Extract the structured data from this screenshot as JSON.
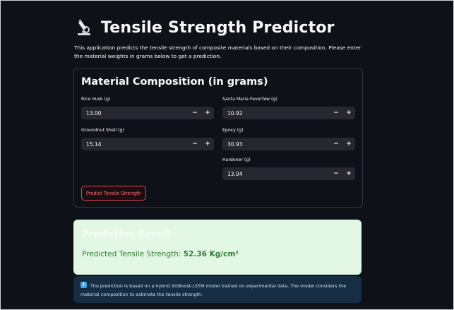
{
  "page": {
    "title": "Tensile Strength Predictor",
    "title_icon": "microscope-icon",
    "intro": "This application predicts the tensile strength of composite materials based on their composition. Please enter the material weights in grams below to get a prediction."
  },
  "form": {
    "title": "Material Composition (in grams)",
    "fields": [
      {
        "label": "Rice Husk (g)",
        "value": "13.00"
      },
      {
        "label": "Santa Maria Feverfew (g)",
        "value": "10.92"
      },
      {
        "label": "Groundnut Shell (g)",
        "value": "15.14"
      },
      {
        "label": "Epoxy (g)",
        "value": "30.93"
      },
      {
        "label": "Hardener (g)",
        "value": "13.04"
      }
    ],
    "minus_label": "−",
    "plus_label": "+",
    "submit_label": "Predict Tensile Strength"
  },
  "result": {
    "heading": "Prediction Result",
    "prefix": "Predicted Tensile Strength: ",
    "value": "52.36 Kg/cm²"
  },
  "info": {
    "icon": "info-icon",
    "icon_glyph": "i",
    "text": "The prediction is based on a hybrid XGBoost-LSTM model trained on experimental data. The model considers the material composition to estimate the tensile strength."
  },
  "colors": {
    "background": "#0e1117",
    "accent_red": "#ff4b4b",
    "success_bg": "#e3f8e4",
    "success_text": "#2e7d32",
    "info_bg": "#172d43"
  }
}
